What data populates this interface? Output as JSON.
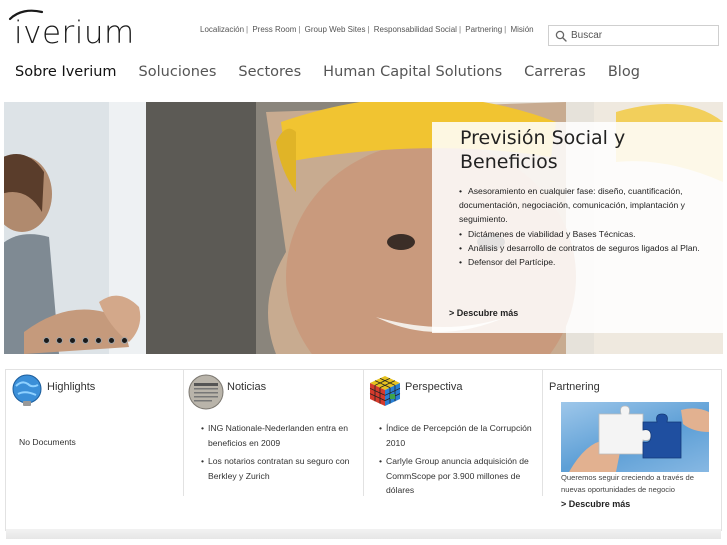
{
  "brand": {
    "logo_text": "iverium"
  },
  "top_links": [
    "Localización",
    "Press Room",
    "Group Web Sites",
    "Responsabilidad Social",
    "Partnering",
    "Misión"
  ],
  "top_links_separator": "|",
  "search": {
    "placeholder": "Buscar",
    "value": "",
    "icon": "search-icon"
  },
  "main_nav": [
    {
      "label": "Sobre Iverium",
      "active": true
    },
    {
      "label": "Soluciones",
      "active": false
    },
    {
      "label": "Sectores",
      "active": false
    },
    {
      "label": "Human Capital Solutions",
      "active": false
    },
    {
      "label": "Carreras",
      "active": false
    },
    {
      "label": "Blog",
      "active": false
    }
  ],
  "hero": {
    "title": "Previsión Social y Beneficios",
    "bullets": [
      "Asesoramiento en cualquier fase: diseño, cuantificación, documentación, negociación, comunicación, implantación y seguimiento.",
      "Dictámenes de viabilidad y Bases Técnicas.",
      "Análisis y desarrollo de contratos de seguros ligados al Plan.",
      "Defensor del Partícipe."
    ],
    "more_label": "> Descubre más",
    "slide_count": 7,
    "active_slide": 1
  },
  "panels": {
    "highlights": {
      "title": "Highlights",
      "icon": "lightbulb-globe-icon",
      "empty_text": "No Documents"
    },
    "noticias": {
      "title": "Noticias",
      "icon": "newspaper-icon",
      "items": [
        "ING Nationale-Nederlanden entra en beneficios en 2009",
        "Los notarios contratan su seguro con Berkley y Zurich"
      ]
    },
    "perspectiva": {
      "title": "Perspectiva",
      "icon": "rubiks-cube-icon",
      "items": [
        "Índice de Percepción de la Corrupción 2010",
        "Carlyle Group anuncia adquisición de CommScope por 3.900 millones de dólares"
      ]
    },
    "partnering": {
      "title": "Partnering",
      "image": "puzzle-hands-image",
      "text": "Queremos seguir creciendo a través de nuevas oportunidades de negocio",
      "more_label": "> Descubre más"
    }
  },
  "colors": {
    "nav_active": "#111111",
    "nav_inactive": "#555555",
    "puzzle_white": "#f4f4f4",
    "puzzle_blue": "#1f4fa0"
  }
}
